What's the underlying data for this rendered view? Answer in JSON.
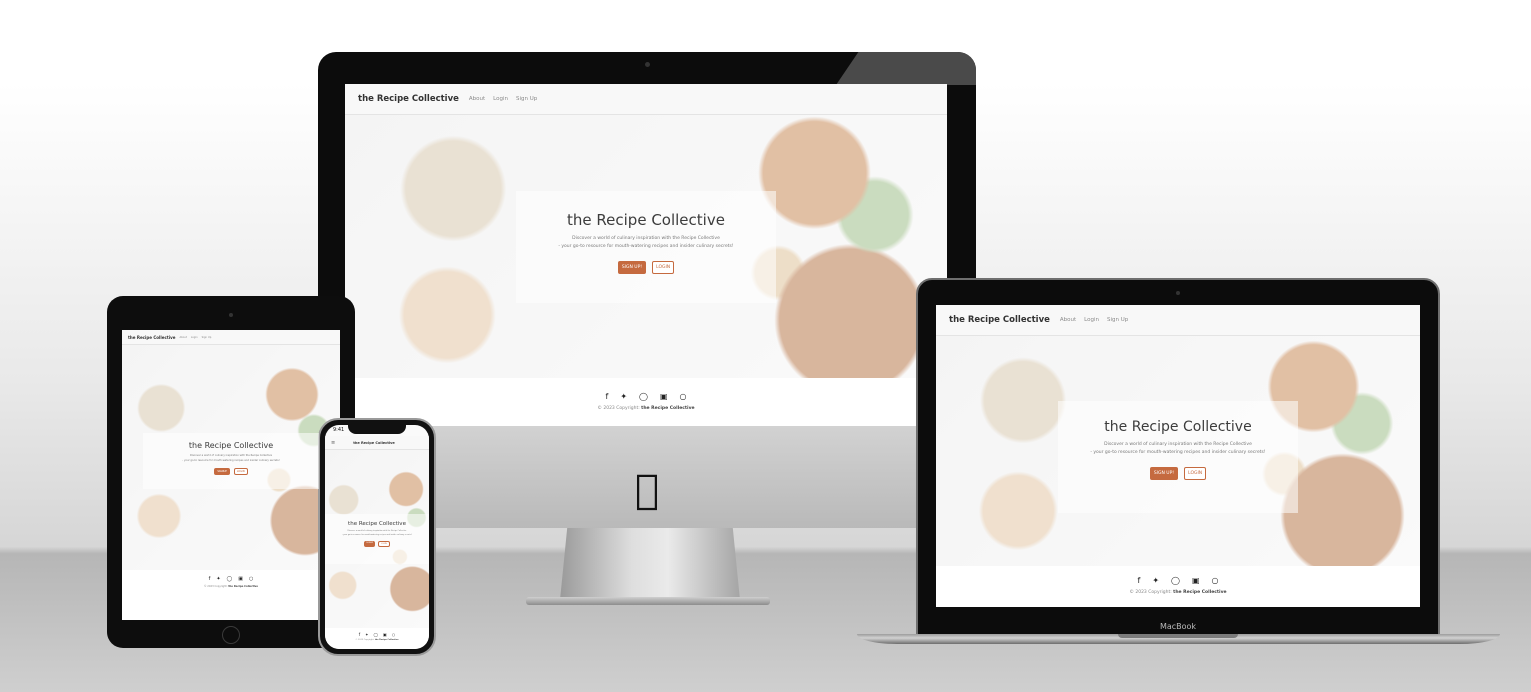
{
  "site": {
    "brand": "the Recipe Collective",
    "nav": [
      "About",
      "Login",
      "Sign Up"
    ],
    "hero_title": "the Recipe Collective",
    "hero_desc_1": "Discover a world of culinary inspiration with the Recipe Collective",
    "hero_desc_2": "- your go-to resource for mouth-watering recipes and insider culinary secrets!",
    "signup_label": "SIGN UP!",
    "login_label": "LOGIN",
    "tablet_signup_label": "SIGNUP",
    "copyright_prefix": "© 2023 Copyright:",
    "copyright_brand": "the Recipe Collective",
    "social_icons": [
      "facebook-icon",
      "twitter-icon",
      "instagram-icon",
      "linkedin-icon",
      "github-icon"
    ]
  },
  "devices": {
    "phone_time": "9:41",
    "laptop_label": "MacBook"
  },
  "colors": {
    "accent": "#c56a3f",
    "device_frame": "#0c0c0c"
  }
}
